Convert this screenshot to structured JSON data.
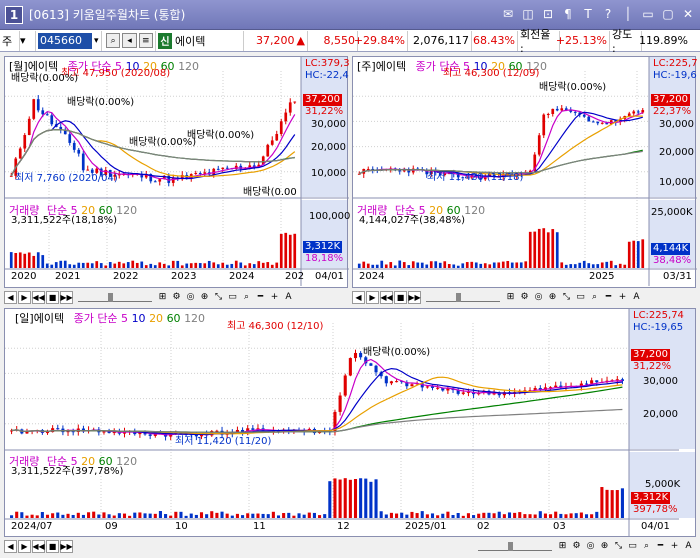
{
  "window": {
    "number": "1",
    "title": "[0613] 키움일주월차트 (통합)",
    "controls": [
      "✉",
      "◫",
      "⊡",
      "¶",
      "T",
      "?",
      "│",
      "▭",
      "▢",
      "✕"
    ]
  },
  "toolbar": {
    "market": "주",
    "code": "045660",
    "sin_label": "신",
    "name": "에이텍",
    "price": "37,200",
    "change": "8,550",
    "change_rate": "+29.84%",
    "volume": "2,076,117",
    "volume_rate": "68.43%",
    "turnover_label": "회전율 :",
    "turnover": "+25.13%",
    "strength_label": "강도 :",
    "strength": "119.89%"
  },
  "colors": {
    "up": "#e00000",
    "down": "#0032c8",
    "ma5": "#c800c8",
    "ma10": "#0000c8",
    "ma20": "#e8a000",
    "ma60": "#008000",
    "ma120": "#808080"
  },
  "legend": {
    "price_series": "종가 단순 5",
    "ma10": "10",
    "ma20": "20",
    "ma60": "60",
    "ma120": "120",
    "volume_label": "거래량",
    "volume_series": "단순 5",
    "vma20": "20",
    "vma60": "60",
    "vma120": "120"
  },
  "monthly": {
    "name": "[월]에이텍",
    "high_note": "최고 47,950 (2020/08)",
    "low_note": "최저 7,760 (2020/04)",
    "dividend_notes": [
      "배당락(0.00%)",
      "배당락(0.00%)",
      "배당락(0.00%)",
      "배당락(0.00%)",
      "배당락(0.00"
    ],
    "lc": "LC:379,3",
    "hc": "HC:-22,4",
    "price_tag": "37,200",
    "pct_tag": "31,22%",
    "y_ticks": [
      "30,000",
      "20,000",
      "10,000"
    ],
    "vol_text": "3,311,522주(18,18%)",
    "vol_ticks": [
      "100,000"
    ],
    "vol_tag": "3,312K",
    "vol_pct": "18,18%",
    "x_labels": [
      "2020",
      "2021",
      "2022",
      "2023",
      "2024",
      "202"
    ],
    "date": "04/01"
  },
  "weekly": {
    "name": "[주]에이텍",
    "high_note": "최고 46,300 (12/09)",
    "low_note": "최저 11,420 (11/18)",
    "dividend_notes": [
      "배당락(0.00%)"
    ],
    "lc": "LC:225,7",
    "hc": "HC:-19,6",
    "price_tag": "37,200",
    "pct_tag": "22,37%",
    "y_ticks": [
      "30,000",
      "20,000",
      "10,000"
    ],
    "vol_text": "4,144,027주(38,48%)",
    "vol_ticks": [
      "25,000K"
    ],
    "vol_tag": "4,144K",
    "vol_pct": "38,48%",
    "x_labels": [
      "2024",
      "2025"
    ],
    "date": "03/31"
  },
  "daily": {
    "name": "[일]에이텍",
    "high_note": "최고 46,300 (12/10)",
    "low_note": "최저 11,420 (11/20)",
    "dividend_notes": [
      "배당락(0.00%)"
    ],
    "lc": "LC:225,74",
    "hc": "HC:-19,65",
    "price_tag": "37,200",
    "pct_tag": "31,22%",
    "y_ticks": [
      "30,000",
      "20,000"
    ],
    "vol_text": "3,311,522주(397,78%)",
    "vol_ticks": [
      "5,000K"
    ],
    "vol_tag": "3,312K",
    "vol_pct": "397,78%",
    "x_labels": [
      "2024/07",
      "09",
      "10",
      "11",
      "12",
      "2025/01",
      "02",
      "03"
    ],
    "date": "04/01"
  },
  "navbar": {
    "buttons": [
      "◀",
      "▶",
      "◀◀",
      "■",
      "▶▶"
    ],
    "tools": [
      "⊞",
      "⚙",
      "◎",
      "⊕",
      "⤡",
      "▭",
      "⌕",
      "━",
      "+",
      "A"
    ]
  }
}
